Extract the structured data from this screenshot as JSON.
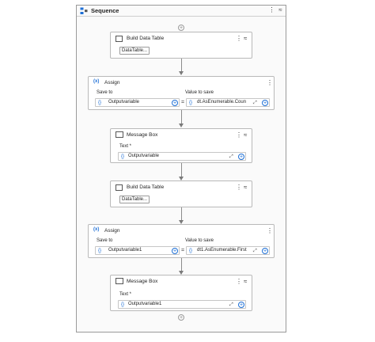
{
  "sequence": {
    "title": "Sequence",
    "kebab": "⋮",
    "collapse": "≈"
  },
  "controls": {
    "kebab": "⋮",
    "collapse": "≈",
    "add": "+",
    "expand": "⤢",
    "brace": "{}",
    "equals": "="
  },
  "activities": [
    {
      "type": "Build Data Table",
      "title": "Build Data Table",
      "button_label": "DataTable..."
    },
    {
      "type": "Assign",
      "title": "Assign",
      "icon_text": "(x)",
      "save_to_label": "Save to",
      "value_label": "Value to save",
      "save_to_value": "Outputvariable",
      "value": "dt.AsEnumerable.Coun"
    },
    {
      "type": "Message Box",
      "title": "Message Box",
      "text_label": "Text *",
      "text_value": "Outputvariable"
    },
    {
      "type": "Build Data Table",
      "title": "Build Data Table",
      "button_label": "DataTable..."
    },
    {
      "type": "Assign",
      "title": "Assign",
      "icon_text": "(x)",
      "save_to_label": "Save to",
      "value_label": "Value to save",
      "save_to_value": "Outputvariable1",
      "value": "dt1.AsEnumerable.First"
    },
    {
      "type": "Message Box",
      "title": "Message Box",
      "text_label": "Text *",
      "text_value": "Outputvariable1"
    }
  ]
}
